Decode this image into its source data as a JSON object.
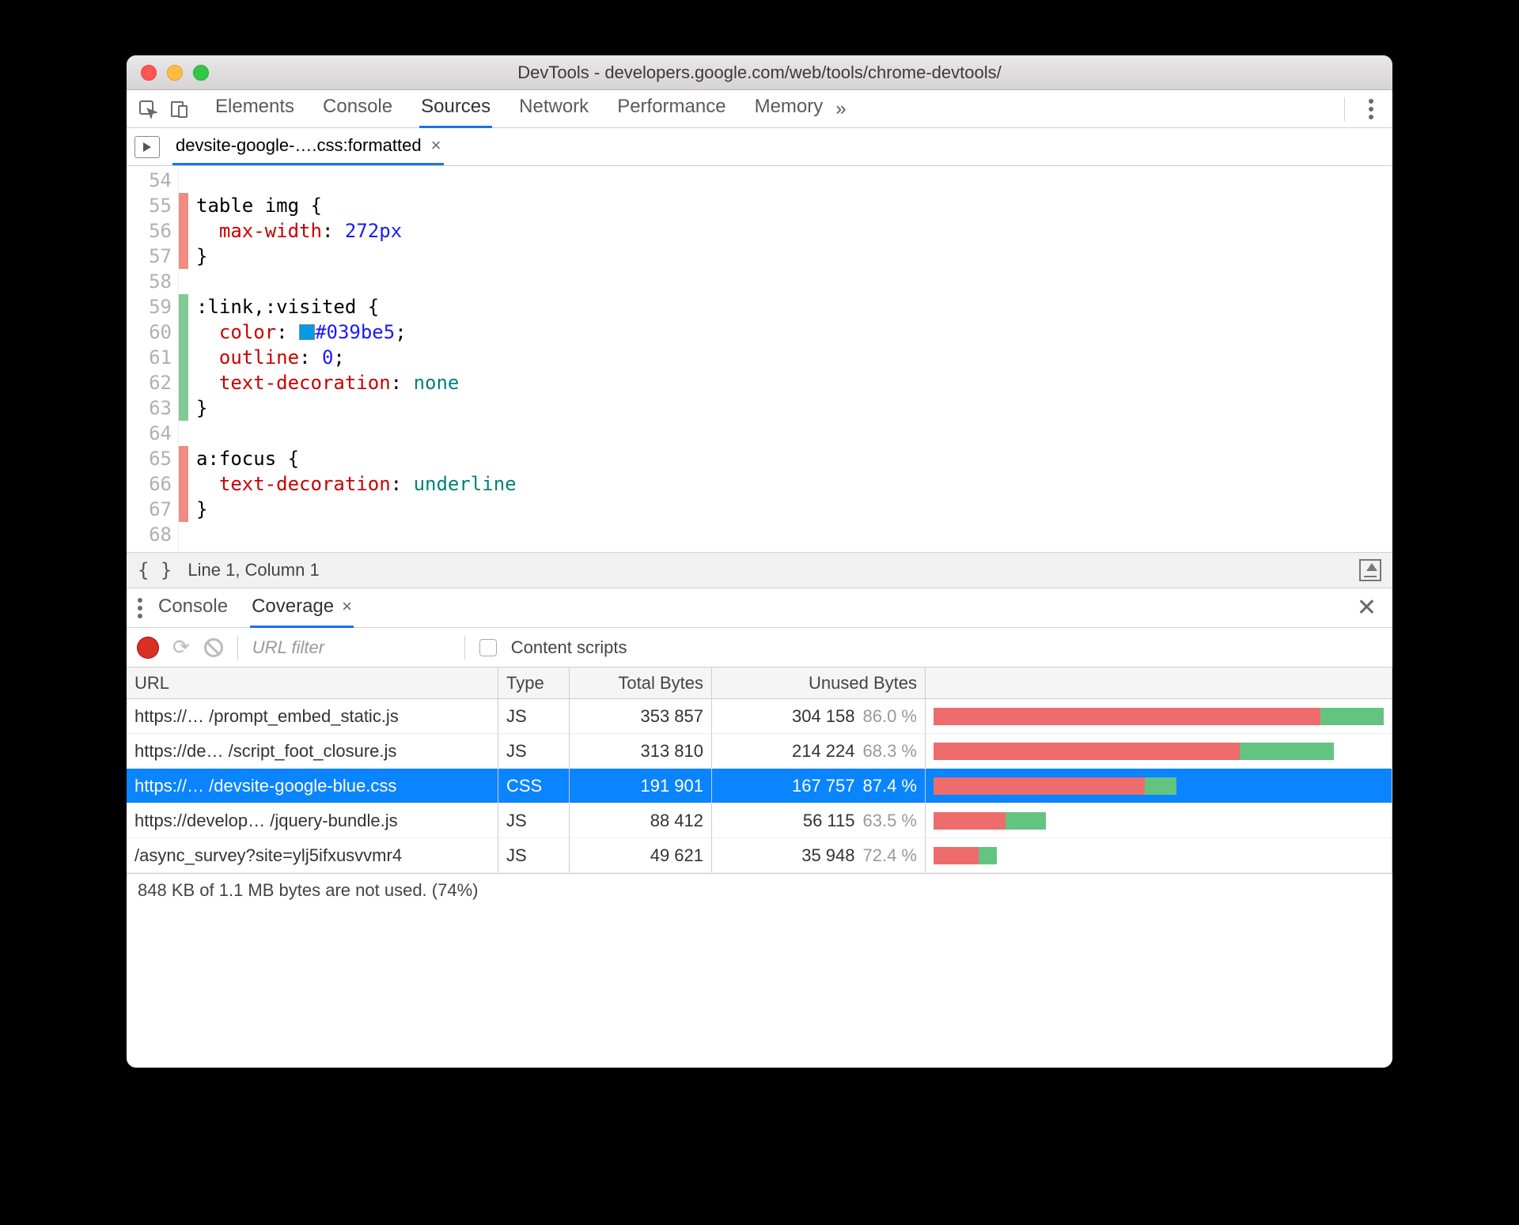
{
  "window": {
    "title": "DevTools - developers.google.com/web/tools/chrome-devtools/"
  },
  "mainTabs": {
    "items": [
      "Elements",
      "Console",
      "Sources",
      "Network",
      "Performance",
      "Memory"
    ],
    "activeIndex": 2,
    "moreGlyph": "»"
  },
  "fileTab": {
    "label": "devsite-google-….css:formatted",
    "close": "×"
  },
  "code": {
    "lines": [
      {
        "n": 54,
        "mark": "",
        "html": ""
      },
      {
        "n": 55,
        "mark": "r",
        "html": "<span class='sel'>table img {</span>"
      },
      {
        "n": 56,
        "mark": "r",
        "html": "  <span class='prop'>max-width</span>: <span class='num'>272px</span>"
      },
      {
        "n": 57,
        "mark": "r",
        "html": "<span class='sel'>}</span>"
      },
      {
        "n": 58,
        "mark": "",
        "html": ""
      },
      {
        "n": 59,
        "mark": "g",
        "html": "<span class='sel'>:link,:visited {</span>"
      },
      {
        "n": 60,
        "mark": "g",
        "html": "  <span class='prop'>color</span>: <span class='swatch' style='background:#039be5'></span><span class='val'>#039be5</span>;"
      },
      {
        "n": 61,
        "mark": "g",
        "html": "  <span class='prop'>outline</span>: <span class='num'>0</span>;"
      },
      {
        "n": 62,
        "mark": "g",
        "html": "  <span class='prop'>text-decoration</span>: <span class='kw'>none</span>"
      },
      {
        "n": 63,
        "mark": "g",
        "html": "<span class='sel'>}</span>"
      },
      {
        "n": 64,
        "mark": "",
        "html": ""
      },
      {
        "n": 65,
        "mark": "r",
        "html": "<span class='sel'>a:focus {</span>"
      },
      {
        "n": 66,
        "mark": "r",
        "html": "  <span class='prop'>text-decoration</span>: <span class='kw'>underline</span>"
      },
      {
        "n": 67,
        "mark": "r",
        "html": "<span class='sel'>}</span>"
      },
      {
        "n": 68,
        "mark": "",
        "html": ""
      }
    ],
    "statusBraces": "{ }",
    "status": "Line 1, Column 1"
  },
  "drawer": {
    "tabs": [
      {
        "label": "Console",
        "active": false
      },
      {
        "label": "Coverage",
        "active": true,
        "close": "×"
      }
    ],
    "closeGlyph": "✕"
  },
  "coverageToolbar": {
    "urlFilterPlaceholder": "URL filter",
    "contentScriptsLabel": "Content scripts"
  },
  "coverageTable": {
    "headers": {
      "url": "URL",
      "type": "Type",
      "total": "Total Bytes",
      "unused": "Unused Bytes"
    },
    "rows": [
      {
        "url": "https://… /prompt_embed_static.js",
        "type": "JS",
        "total": "353 857",
        "unused": "304 158",
        "pct": "86.0 %",
        "barTotal": 100,
        "barUnused": 86,
        "selected": false
      },
      {
        "url": "https://de… /script_foot_closure.js",
        "type": "JS",
        "total": "313 810",
        "unused": "214 224",
        "pct": "68.3 %",
        "barTotal": 89,
        "barUnused": 68,
        "selected": false
      },
      {
        "url": "https://… /devsite-google-blue.css",
        "type": "CSS",
        "total": "191 901",
        "unused": "167 757",
        "pct": "87.4 %",
        "barTotal": 54,
        "barUnused": 47,
        "selected": true
      },
      {
        "url": "https://develop… /jquery-bundle.js",
        "type": "JS",
        "total": "88 412",
        "unused": "56 115",
        "pct": "63.5 %",
        "barTotal": 25,
        "barUnused": 16,
        "selected": false
      },
      {
        "url": "/async_survey?site=ylj5ifxusvvmr4",
        "type": "JS",
        "total": "49 621",
        "unused": "35 948",
        "pct": "72.4 %",
        "barTotal": 14,
        "barUnused": 10,
        "selected": false
      }
    ],
    "footer": "848 KB of 1.1 MB bytes are not used. (74%)"
  }
}
